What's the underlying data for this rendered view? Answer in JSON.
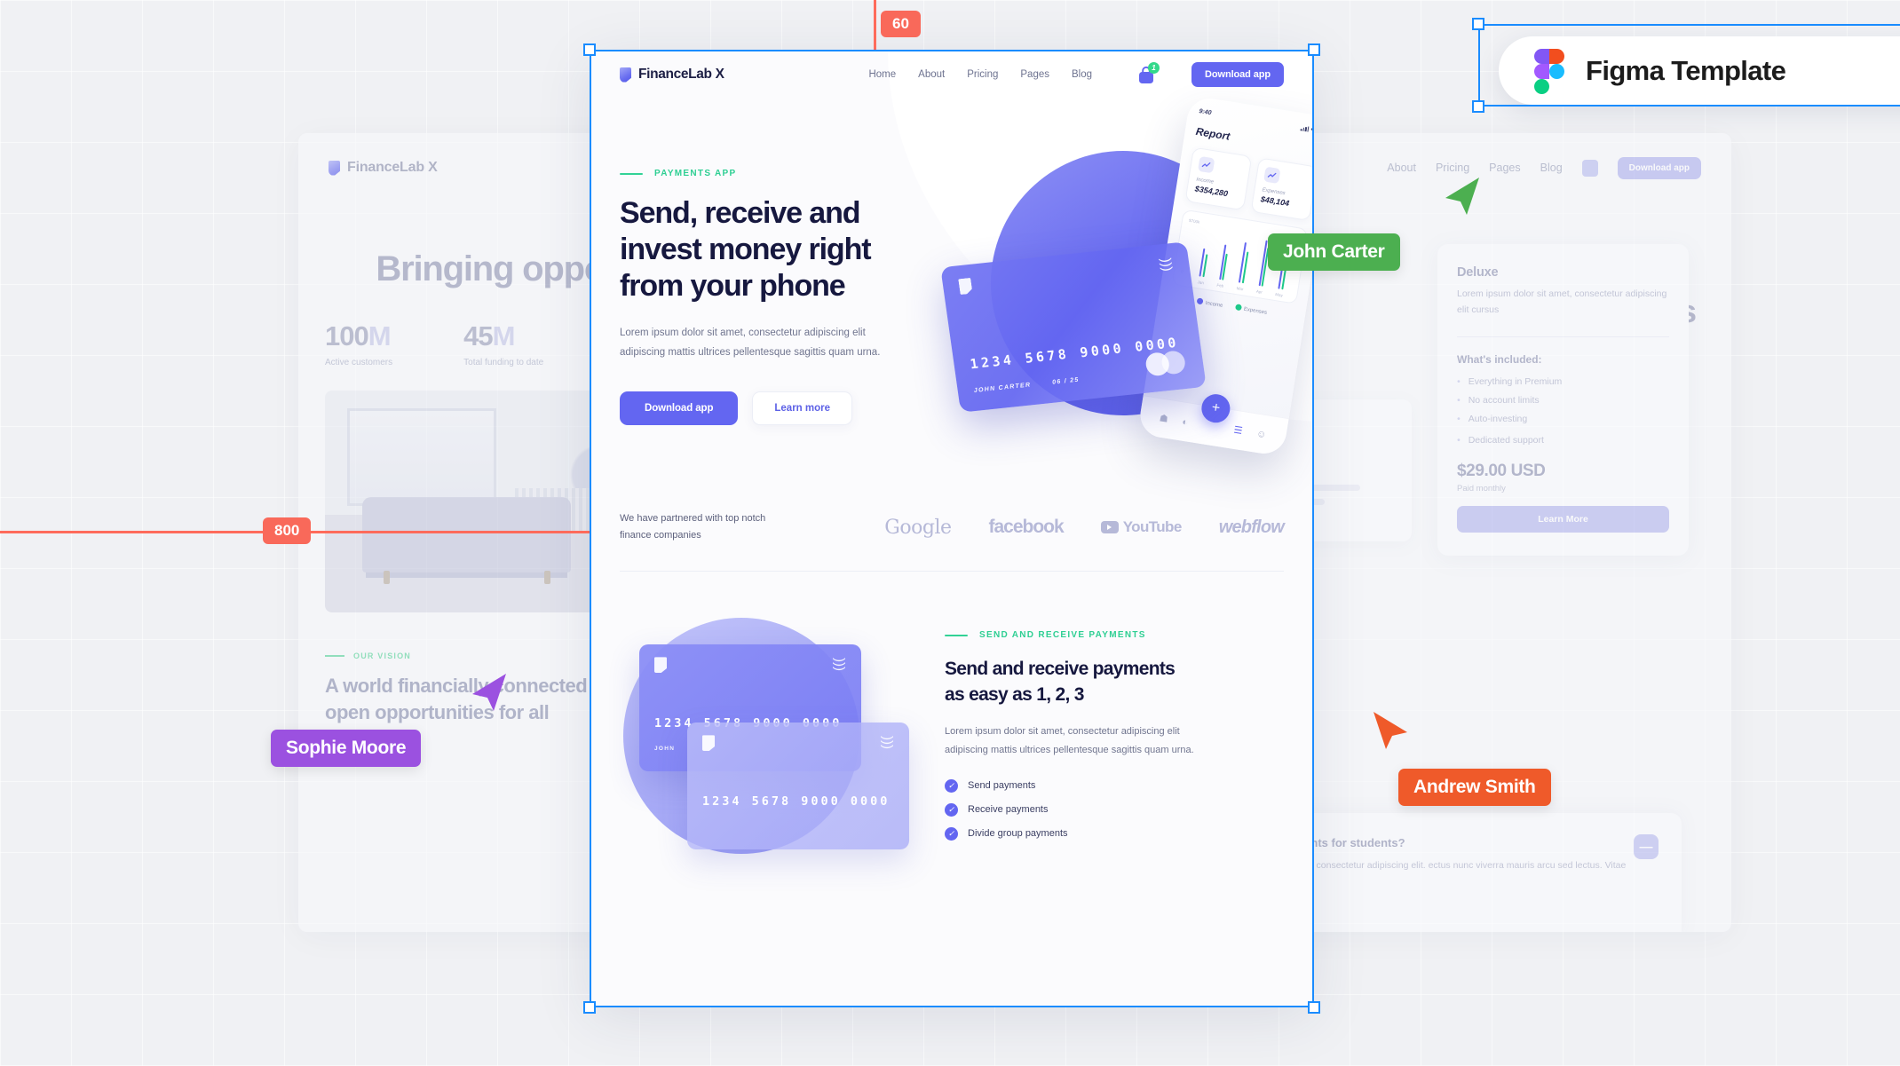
{
  "figma_badge": {
    "label": "Figma Template",
    "logo_icon": "figma-logo-icon"
  },
  "measurements": [
    {
      "value": "60",
      "orientation": "vertical"
    },
    {
      "value": "800",
      "orientation": "horizontal"
    }
  ],
  "cursors": [
    {
      "name": "John Carter",
      "color": "#4caf50"
    },
    {
      "name": "Sophie Moore",
      "color": "#9b51e0"
    },
    {
      "name": "Andrew Smith",
      "color": "#ef5a2a"
    }
  ],
  "main_page": {
    "nav": {
      "brand": "FinanceLab X",
      "links": [
        "Home",
        "About",
        "Pricing",
        "Pages",
        "Blog"
      ],
      "cart_badge": "1",
      "cta": "Download app"
    },
    "hero": {
      "eyebrow": "PAYMENTS APP",
      "title": "Send, receive and invest money right from your phone",
      "subtitle": "Lorem ipsum dolor sit amet, consectetur adipiscing elit adipiscing mattis ultrices pellentesque sagittis quam urna.",
      "primary_btn": "Download app",
      "secondary_btn": "Learn more"
    },
    "phone": {
      "time": "9:40",
      "screen_title": "Report",
      "stats": [
        {
          "label": "Income",
          "value": "$354,280"
        },
        {
          "label": "Expenses",
          "value": "$48,104"
        }
      ],
      "chart": {
        "y_top": "$700k",
        "y_bottom": "0",
        "months": [
          "Jan",
          "Feb",
          "Mar",
          "Apr",
          "May"
        ]
      },
      "legend": [
        "Income",
        "Expenses"
      ],
      "fab": "+"
    },
    "credit_card": {
      "number": "1234 5678 9000 0000",
      "holder": "JOHN CARTER",
      "expiry": "06 / 25"
    },
    "partners": {
      "text": "We have partnered with top notch finance companies",
      "logos": [
        "Google",
        "facebook",
        "YouTube",
        "webflow"
      ]
    },
    "lower": {
      "eyebrow": "SEND AND RECEIVE PAYMENTS",
      "title": "Send and receive payments as easy as 1, 2, 3",
      "body": "Lorem ipsum dolor sit amet, consectetur adipiscing elit adipiscing mattis ultrices pellentesque sagittis quam urna.",
      "checklist": [
        "Send payments",
        "Receive payments",
        "Divide group payments"
      ],
      "card_number": "1234 5678 9000 0000",
      "card_holder": "JOHN"
    }
  },
  "bg_left_page": {
    "brand": "FinanceLab X",
    "hero_title": "Bringing opportuniti",
    "stats": [
      {
        "number": "100",
        "suffix": "M",
        "label": "Active customers"
      },
      {
        "number": "45",
        "suffix": "M",
        "label": "Total funding to date"
      }
    ],
    "vision_eyebrow": "OUR VISION",
    "vision_title": "A world financially connected and with open opportunities for all"
  },
  "bg_right_page": {
    "links": [
      "About",
      "Pricing",
      "Pages",
      "Blog"
    ],
    "cta": "Download app",
    "hero_fragment": "earners",
    "price_card": {
      "plan": "Deluxe",
      "desc": "Lorem ipsum dolor sit amet, consectetur adipiscing elit cursus",
      "included_label": "What's included:",
      "features": [
        "Everything in Premium",
        "No account limits",
        "Auto-investing",
        "Dedicated support"
      ],
      "price": "$29.00 USD",
      "period": "Paid monthly",
      "cta": "Learn More"
    },
    "faq": {
      "question": "offer discounts for students?",
      "answer": "m dolor sit amet, consectetur adipiscing elit. ectus nunc viverra mauris arcu sed lectus. Vitae",
      "toggle": "—"
    }
  }
}
